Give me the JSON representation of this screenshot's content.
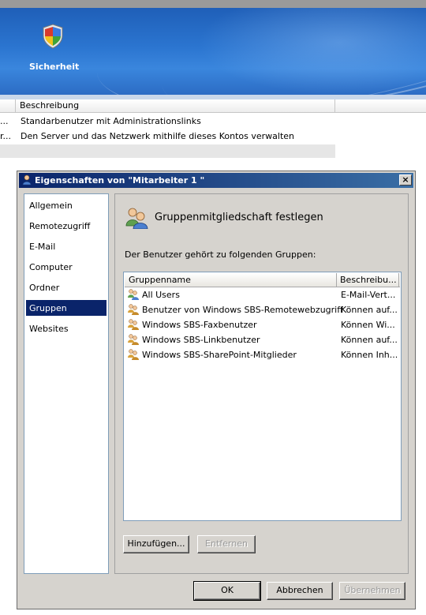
{
  "banner": {
    "label": "Sicherheit",
    "icon": "security-shield-icon"
  },
  "background_list": {
    "column_header": "Beschreibung",
    "rows": [
      {
        "col1": "...",
        "description": "Standarbenutzer mit Administrationslinks"
      },
      {
        "col1": "r...",
        "description": "Den Server und das Netzwerk mithilfe dieses Kontos verwalten"
      }
    ]
  },
  "dialog": {
    "title": "Eigenschaften von \"Mitarbeiter 1 \"",
    "close_label": "×",
    "nav": [
      {
        "label": "Allgemein",
        "selected": false
      },
      {
        "label": "Remotezugriff",
        "selected": false
      },
      {
        "label": "E-Mail",
        "selected": false
      },
      {
        "label": "Computer",
        "selected": false
      },
      {
        "label": "Ordner",
        "selected": false
      },
      {
        "label": "Gruppen",
        "selected": true
      },
      {
        "label": "Websites",
        "selected": false
      }
    ],
    "content": {
      "heading": "Gruppenmitgliedschaft festlegen",
      "description": "Der Benutzer gehört zu folgenden Gruppen:",
      "columns": [
        "Gruppenname",
        "Beschreibu..."
      ],
      "groups": [
        {
          "name": "All Users",
          "description": "E-Mail-Vert..."
        },
        {
          "name": "Benutzer von Windows SBS-Remotewebzugriff",
          "description": "Können auf..."
        },
        {
          "name": "Windows SBS-Faxbenutzer",
          "description": "Können Wi..."
        },
        {
          "name": "Windows SBS-Linkbenutzer",
          "description": "Können auf..."
        },
        {
          "name": "Windows SBS-SharePoint-Mitglieder",
          "description": "Können Inh..."
        }
      ],
      "add_button": "Hinzufügen...",
      "remove_button": "Entfernen"
    },
    "buttons": {
      "ok": "OK",
      "cancel": "Abbrechen",
      "apply": "Übernehmen"
    }
  },
  "colors": {
    "banner_blue": "#2b75d0",
    "selection": "#0a246a",
    "dialog_face": "#d6d3ce"
  }
}
